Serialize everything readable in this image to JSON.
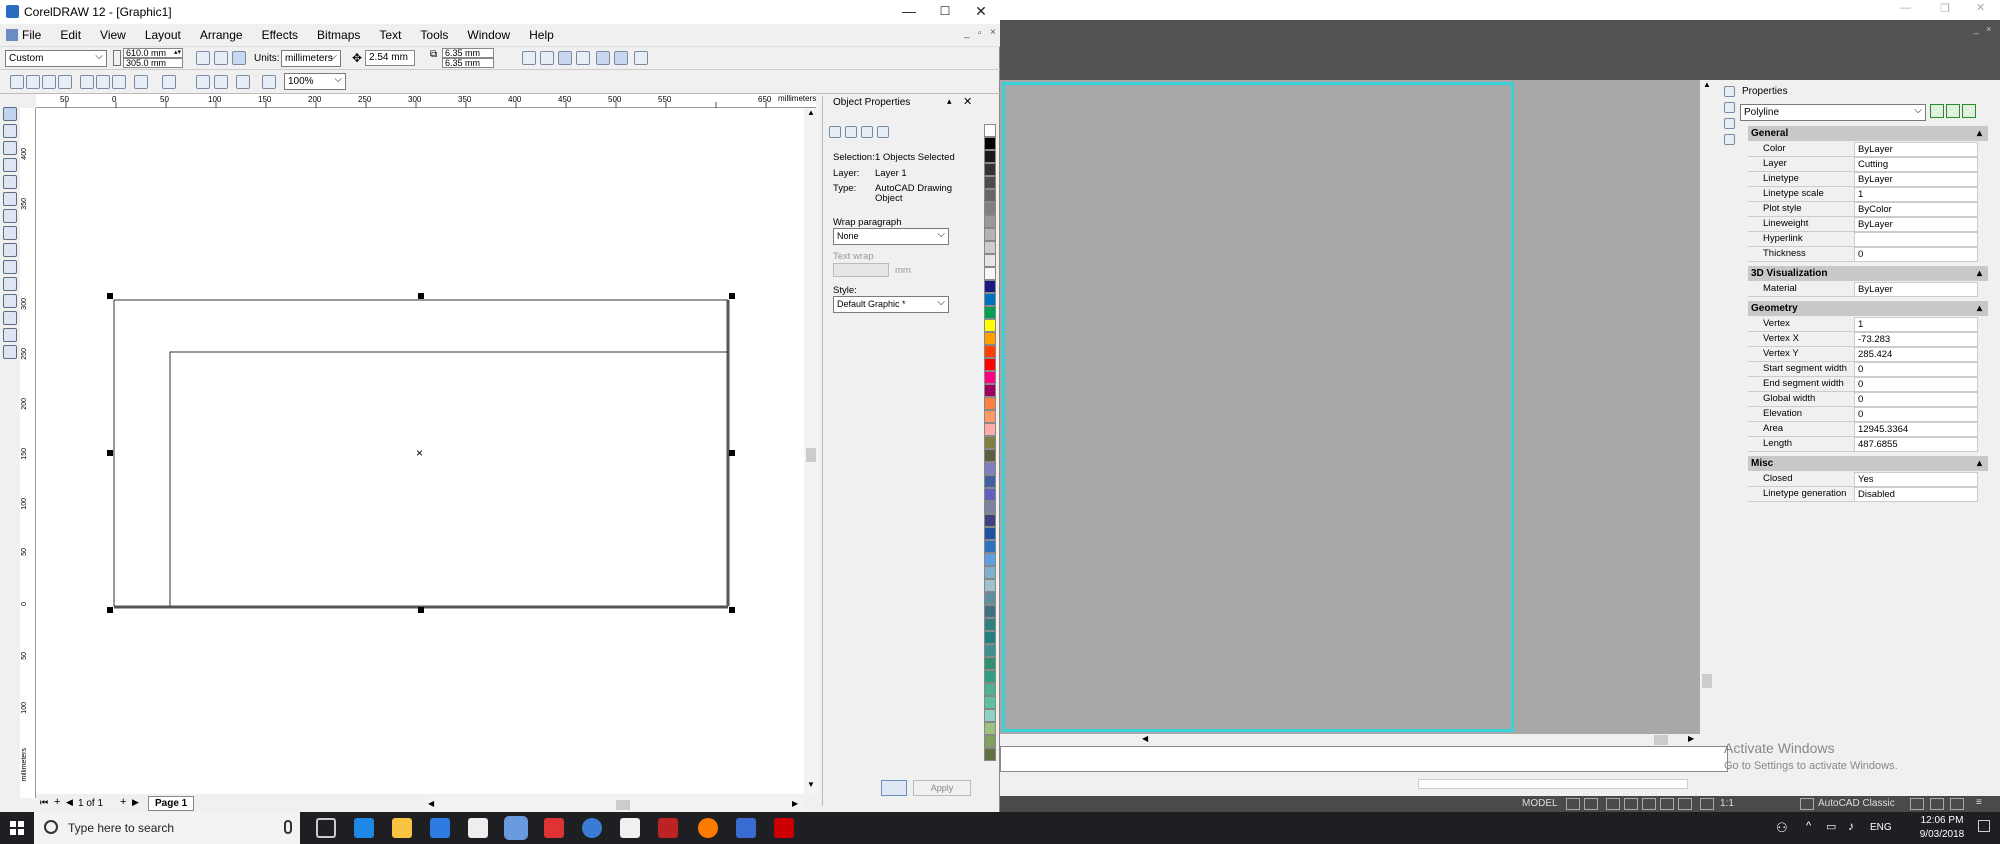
{
  "corel": {
    "title": "CorelDRAW 12 - [Graphic1]",
    "menu": [
      "File",
      "Edit",
      "View",
      "Layout",
      "Arrange",
      "Effects",
      "Bitmaps",
      "Text",
      "Tools",
      "Window",
      "Help"
    ],
    "paper_preset": "Custom",
    "width": "610.0 mm",
    "height": "305.0 mm",
    "units_label": "Units:",
    "units": "millimeters",
    "nudge": "2.54 mm",
    "dup_x": "6.35 mm",
    "dup_y": "6.35 mm",
    "zoom": "100%",
    "ruler_top": [
      "50",
      "0",
      "50",
      "100",
      "150",
      "200",
      "250",
      "300",
      "350",
      "400",
      "450",
      "500",
      "550",
      "600",
      "650",
      "millimeters"
    ],
    "ruler_left": [
      "400",
      "350",
      "300",
      "250",
      "200",
      "150",
      "100",
      "50",
      "0",
      "50",
      "100",
      "millimeters"
    ],
    "page_count": "1 of 1",
    "page_tab": "Page 1",
    "docker": {
      "title": "Object Properties",
      "selection_label": "Selection:",
      "selection_value": "1 Objects Selected",
      "layer_label": "Layer:",
      "layer_value": "Layer 1",
      "type_label": "Type:",
      "type_value_1": "AutoCAD Drawing",
      "type_value_2": "Object",
      "wrap_label": "Wrap paragraph",
      "wrap_value": "None",
      "textwrap_label": "Text wrap",
      "textwrap_unit": "mm",
      "style_label": "Style:",
      "style_value": "Default Graphic *",
      "apply": "Apply"
    },
    "palette": [
      "#ffffff",
      "#000000",
      "#1a1a1a",
      "#333333",
      "#4d4d4d",
      "#666666",
      "#808080",
      "#999999",
      "#b3b3b3",
      "#cccccc",
      "#e6e6e6",
      "#f7f7f7",
      "#1a1a80",
      "#0070c0",
      "#00a050",
      "#ffff00",
      "#ffa000",
      "#ff4000",
      "#ff0000",
      "#ff0080",
      "#a00060",
      "#ff8040",
      "#ff9966",
      "#ffaaaa",
      "#808040",
      "#606040",
      "#8080c0",
      "#4060a0",
      "#6060c0",
      "#8080a0",
      "#404080",
      "#2050a0",
      "#3070c0",
      "#60a0e0",
      "#80b0d0",
      "#a0c0d0",
      "#6090a0",
      "#407080",
      "#308080",
      "#208080",
      "#409090",
      "#309070",
      "#30a080",
      "#50b090",
      "#60c0a0",
      "#90d0c0",
      "#a0c080",
      "#80a060",
      "#607040"
    ]
  },
  "acad": {
    "properties_title": "Properties",
    "object_type": "Polyline",
    "sections": [
      {
        "name": "General",
        "rows": [
          [
            "Color",
            "ByLayer"
          ],
          [
            "Layer",
            "Cutting"
          ],
          [
            "Linetype",
            "ByLayer"
          ],
          [
            "Linetype scale",
            "1"
          ],
          [
            "Plot style",
            "ByColor"
          ],
          [
            "Lineweight",
            "ByLayer"
          ],
          [
            "Hyperlink",
            ""
          ],
          [
            "Thickness",
            "0"
          ]
        ]
      },
      {
        "name": "3D Visualization",
        "rows": [
          [
            "Material",
            "ByLayer"
          ]
        ]
      },
      {
        "name": "Geometry",
        "rows": [
          [
            "Vertex",
            "1"
          ],
          [
            "Vertex X",
            "-73.283"
          ],
          [
            "Vertex Y",
            "285.424"
          ],
          [
            "Start segment width",
            "0"
          ],
          [
            "End segment width",
            "0"
          ],
          [
            "Global width",
            "0"
          ],
          [
            "Elevation",
            "0"
          ],
          [
            "Area",
            "12945.3364"
          ],
          [
            "Length",
            "487.6855"
          ]
        ]
      },
      {
        "name": "Misc",
        "rows": [
          [
            "Closed",
            "Yes"
          ],
          [
            "Linetype generation",
            "Disabled"
          ]
        ]
      }
    ],
    "watermark_title": "Activate Windows",
    "watermark_sub": "Go to Settings to activate Windows.",
    "status_model": "MODEL",
    "status_scale": "1:1",
    "status_workspace": "AutoCAD Classic"
  },
  "taskbar": {
    "search_placeholder": "Type here to search",
    "time": "12:06 PM",
    "date": "9/03/2018",
    "lang": "ENG"
  }
}
